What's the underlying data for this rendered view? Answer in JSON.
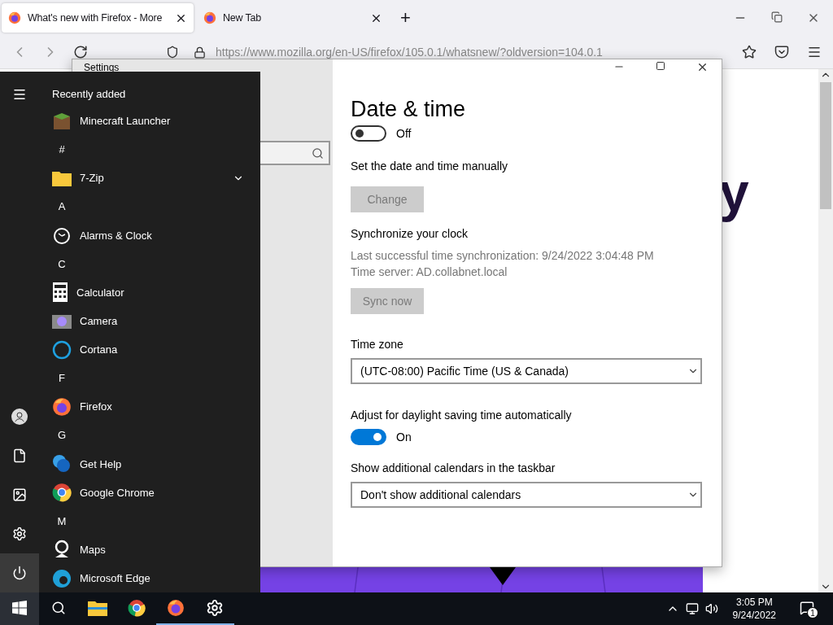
{
  "browser": {
    "tabs": [
      {
        "title": "What's new with Firefox - More",
        "selected": true
      },
      {
        "title": "New Tab",
        "selected": false
      }
    ],
    "new_tab": "+",
    "url": "https://www.mozilla.org/en-US/firefox/105.0.1/whatsnew/?oldversion=104.0.1",
    "page_heading": "y"
  },
  "settings": {
    "window_title": "Settings",
    "page_title": "Date & time",
    "sections": [
      {
        "kind": "toggle",
        "on": false,
        "state_label": "Off"
      },
      {
        "kind": "button",
        "heading": "Set the date and time manually",
        "button": "Change",
        "disabled": true
      },
      {
        "kind": "info",
        "heading": "Synchronize your clock",
        "lines": [
          "Last successful time synchronization: 9/24/2022 3:04:48 PM",
          "Time server: AD.collabnet.local"
        ],
        "button": "Sync now",
        "disabled": true
      },
      {
        "kind": "dropdown",
        "heading": "Time zone",
        "value": "(UTC-08:00) Pacific Time (US & Canada)"
      },
      {
        "kind": "toggle",
        "heading": "Adjust for daylight saving time automatically",
        "on": true,
        "state_label": "On"
      },
      {
        "kind": "dropdown",
        "heading": "Show additional calendars in the taskbar",
        "value": "Don't show additional calendars"
      }
    ]
  },
  "start_menu": {
    "header": "Recently added",
    "items": [
      {
        "kind": "app",
        "label": "Minecraft Launcher"
      },
      {
        "kind": "letter",
        "label": "#"
      },
      {
        "kind": "folder",
        "label": "7-Zip"
      },
      {
        "kind": "letter",
        "label": "A"
      },
      {
        "kind": "app",
        "label": "Alarms & Clock"
      },
      {
        "kind": "letter",
        "label": "C"
      },
      {
        "kind": "app",
        "label": "Calculator"
      },
      {
        "kind": "app",
        "label": "Camera"
      },
      {
        "kind": "app",
        "label": "Cortana"
      },
      {
        "kind": "letter",
        "label": "F"
      },
      {
        "kind": "app",
        "label": "Firefox"
      },
      {
        "kind": "letter",
        "label": "G"
      },
      {
        "kind": "app",
        "label": "Get Help"
      },
      {
        "kind": "app",
        "label": "Google Chrome"
      },
      {
        "kind": "letter",
        "label": "M"
      },
      {
        "kind": "app",
        "label": "Maps"
      },
      {
        "kind": "app",
        "label": "Microsoft Edge"
      }
    ]
  },
  "taskbar": {
    "apps": [
      {
        "active": false
      },
      {
        "active": false
      },
      {
        "active": true
      },
      {
        "active": true
      }
    ],
    "time": "3:05 PM",
    "date": "9/24/2022",
    "notifications": "1"
  }
}
